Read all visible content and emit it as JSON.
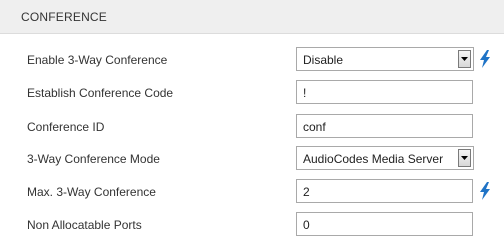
{
  "section": {
    "title": "CONFERENCE"
  },
  "rows": [
    {
      "label": "Enable 3-Way Conference",
      "value": "Disable",
      "kind": "select",
      "has_bolt": true
    },
    {
      "label": "Establish Conference Code",
      "value": "!",
      "kind": "input",
      "has_bolt": false
    },
    {
      "label": "Conference ID",
      "value": "conf",
      "kind": "input",
      "has_bolt": false
    },
    {
      "label": "3-Way Conference Mode",
      "value": "AudioCodes Media Server",
      "kind": "select",
      "has_bolt": false
    },
    {
      "label": "Max. 3-Way Conference",
      "value": "2",
      "kind": "input",
      "has_bolt": true
    },
    {
      "label": "Non Allocatable Ports",
      "value": "0",
      "kind": "input",
      "has_bolt": false
    }
  ],
  "colors": {
    "bolt": "#1f73c6",
    "header_bg": "#efefef"
  },
  "icons": {
    "bolt": "lightning-bolt-icon",
    "dropdown": "chevron-down-icon"
  }
}
